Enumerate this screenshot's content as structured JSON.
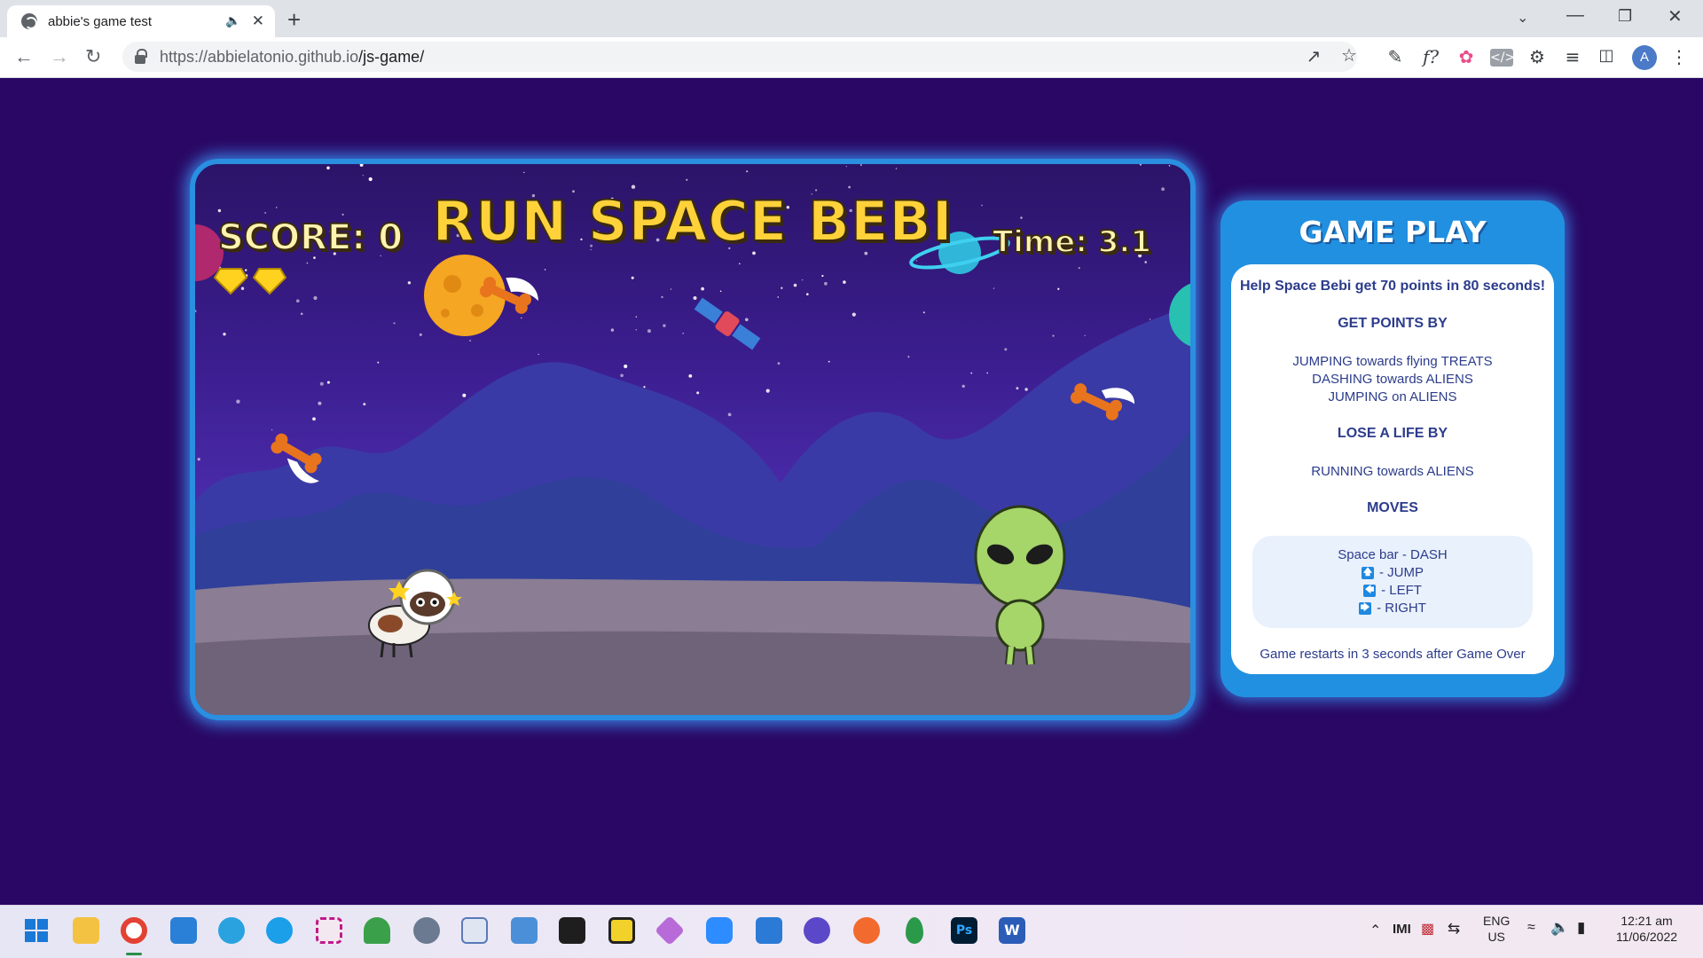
{
  "browser": {
    "tab_title": "abbie's game test",
    "url_host": "https://abbielatonio.github.io",
    "url_path": "/js-game/",
    "avatar_letter": "A"
  },
  "game": {
    "title": "RUN SPACE BEBI",
    "score_label": "SCORE: 0",
    "time_label": "Time: 3.1",
    "score": 0,
    "time": 3.1,
    "lives_shown": 2
  },
  "panel": {
    "title": "GAME PLAY",
    "intro": "Help Space Bebi get 70 points in 80 seconds!",
    "get_points_header": "GET POINTS BY",
    "get_points": [
      "JUMPING towards flying TREATS",
      "DASHING towards ALIENS",
      "JUMPING on ALIENS"
    ],
    "lose_life_header": "LOSE A LIFE BY",
    "lose_life": [
      "RUNNING towards ALIENS"
    ],
    "moves_header": "MOVES",
    "moves": {
      "dash": "Space bar - DASH",
      "jump": "- JUMP",
      "left": "- LEFT",
      "right": "- RIGHT"
    },
    "footer": "Game restarts in 3 seconds after Game Over"
  },
  "taskbar": {
    "lang": "ENG",
    "region": "US",
    "time": "12:21 am",
    "date": "11/06/2022"
  }
}
